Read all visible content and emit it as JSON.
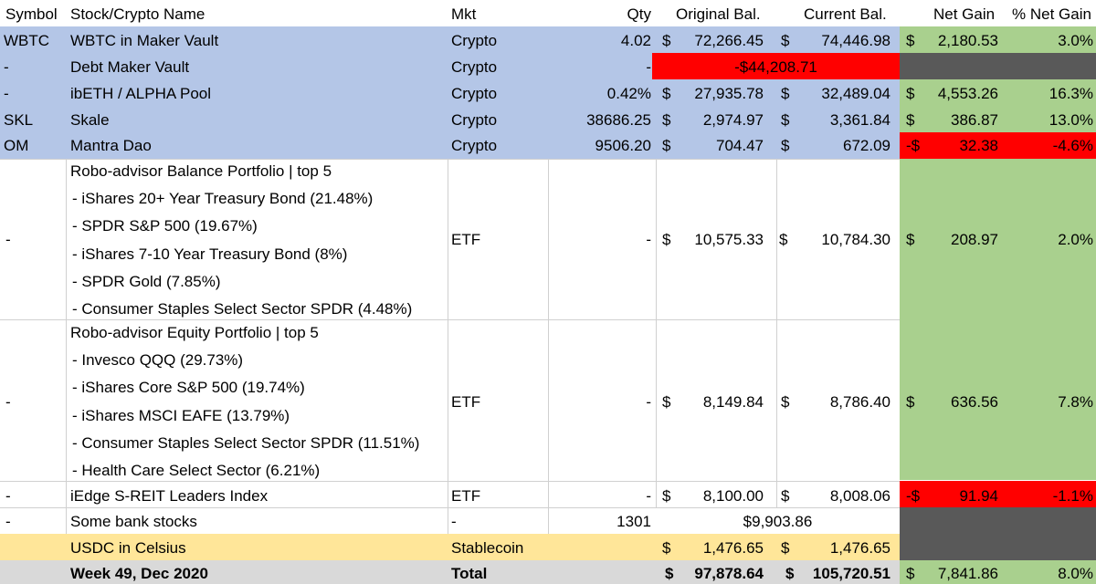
{
  "colors": {
    "crypto_row": "#b4c6e7",
    "gain_green": "#a9d08e",
    "loss_red": "#ff0000",
    "dark_gray": "#595959",
    "stablecoin_yellow": "#ffe699",
    "total_row": "#d9d9d9"
  },
  "headers": {
    "symbol": "Symbol",
    "name": "Stock/Crypto Name",
    "mkt": "Mkt",
    "qty": "Qty",
    "orig": "Original Bal.",
    "curr": "Current Bal.",
    "gain": "Net Gain",
    "pct": "% Net Gain"
  },
  "rows": [
    {
      "symbol": "WBTC",
      "name": "WBTC in Maker Vault",
      "mkt": "Crypto",
      "qty": "4.02",
      "orig_cur": "$",
      "orig": "72,266.45",
      "curr_cur": "$",
      "curr": "74,446.98",
      "gain_cur": "$",
      "gain": "2,180.53",
      "pct": "3.0%"
    },
    {
      "symbol": "-",
      "name": "Debt Maker Vault",
      "mkt": "Crypto",
      "qty": "-",
      "merged": "-$44,208.71"
    },
    {
      "symbol": "-",
      "name": "ibETH / ALPHA Pool",
      "mkt": "Crypto",
      "qty": "0.42%",
      "orig_cur": "$",
      "orig": "27,935.78",
      "curr_cur": "$",
      "curr": "32,489.04",
      "gain_cur": "$",
      "gain": "4,553.26",
      "pct": "16.3%"
    },
    {
      "symbol": "SKL",
      "name": "Skale",
      "mkt": "Crypto",
      "qty": "38686.25",
      "orig_cur": "$",
      "orig": "2,974.97",
      "curr_cur": "$",
      "curr": "3,361.84",
      "gain_cur": "$",
      "gain": "386.87",
      "pct": "13.0%"
    },
    {
      "symbol": "OM",
      "name": "Mantra Dao",
      "mkt": "Crypto",
      "qty": "9506.20",
      "orig_cur": "$",
      "orig": "704.47",
      "curr_cur": "$",
      "curr": "672.09",
      "gain_cur": "-$",
      "gain": "32.38",
      "pct": "-4.6%"
    },
    {
      "symbol": "-",
      "name": "Robo-advisor Balance Portfolio | top 5",
      "sub": [
        "- iShares 20+ Year Treasury Bond (21.48%)",
        "- SPDR S&P 500 (19.67%)",
        "- iShares 7-10 Year Treasury Bond (8%)",
        "- SPDR Gold (7.85%)",
        "- Consumer Staples Select Sector SPDR (4.48%)"
      ],
      "mkt": "ETF",
      "qty": "-",
      "orig_cur": "$",
      "orig": "10,575.33",
      "curr_cur": "$",
      "curr": "10,784.30",
      "gain_cur": "$",
      "gain": "208.97",
      "pct": "2.0%"
    },
    {
      "symbol": "-",
      "name": "Robo-advisor Equity Portfolio | top 5",
      "sub": [
        "- Invesco QQQ (29.73%)",
        "- iShares Core S&P 500 (19.74%)",
        "- iShares MSCI EAFE (13.79%)",
        "- Consumer Staples Select Sector SPDR (11.51%)",
        "- Health Care Select Sector (6.21%)"
      ],
      "mkt": "ETF",
      "qty": "-",
      "orig_cur": "$",
      "orig": "8,149.84",
      "curr_cur": "$",
      "curr": "8,786.40",
      "gain_cur": "$",
      "gain": "636.56",
      "pct": "7.8%"
    },
    {
      "symbol": "-",
      "name": "iEdge S-REIT Leaders Index",
      "mkt": "ETF",
      "qty": "-",
      "orig_cur": "$",
      "orig": "8,100.00",
      "curr_cur": "$",
      "curr": "8,008.06",
      "gain_cur": "-$",
      "gain": "91.94",
      "pct": "-1.1%"
    },
    {
      "symbol": "-",
      "name": "Some bank stocks",
      "mkt": "-",
      "qty": "1301",
      "merged": "$9,903.86"
    },
    {
      "symbol": "",
      "name": "USDC in Celsius",
      "mkt": "Stablecoin",
      "qty": "",
      "orig_cur": "$",
      "orig": "1,476.65",
      "curr_cur": "$",
      "curr": "1,476.65"
    }
  ],
  "total": {
    "label": "Week 49, Dec 2020",
    "mkt": "Total",
    "orig_cur": "$",
    "orig": "97,878.64",
    "curr_cur": "$",
    "curr": "105,720.51",
    "gain_cur": "$",
    "gain": "7,841.86",
    "pct": "8.0%"
  }
}
